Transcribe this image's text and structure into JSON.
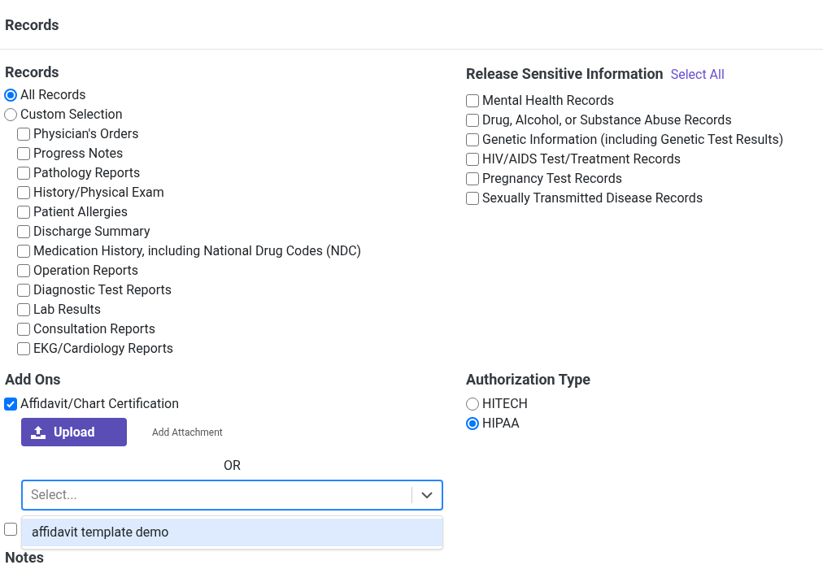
{
  "page_title": "Records",
  "records": {
    "heading": "Records",
    "options": [
      {
        "label": "All Records",
        "selected": true
      },
      {
        "label": "Custom Selection",
        "selected": false
      }
    ],
    "items": [
      {
        "label": "Physician's Orders",
        "checked": false
      },
      {
        "label": "Progress Notes",
        "checked": false
      },
      {
        "label": "Pathology Reports",
        "checked": false
      },
      {
        "label": "History/Physical Exam",
        "checked": false
      },
      {
        "label": "Patient Allergies",
        "checked": false
      },
      {
        "label": "Discharge Summary",
        "checked": false
      },
      {
        "label": "Medication History, including National Drug Codes (NDC)",
        "checked": false
      },
      {
        "label": "Operation Reports",
        "checked": false
      },
      {
        "label": "Diagnostic Test Reports",
        "checked": false
      },
      {
        "label": "Lab Results",
        "checked": false
      },
      {
        "label": "Consultation Reports",
        "checked": false
      },
      {
        "label": "EKG/Cardiology Reports",
        "checked": false
      }
    ]
  },
  "sensitive": {
    "heading": "Release Sensitive Information",
    "select_all": "Select All",
    "items": [
      {
        "label": "Mental Health Records",
        "checked": false
      },
      {
        "label": "Drug, Alcohol, or Substance Abuse Records",
        "checked": false
      },
      {
        "label": "Genetic Information (including Genetic Test Results)",
        "checked": false
      },
      {
        "label": "HIV/AIDS Test/Treatment Records",
        "checked": false
      },
      {
        "label": "Pregnancy Test Records",
        "checked": false
      },
      {
        "label": "Sexually Transmitted Disease Records",
        "checked": false
      }
    ]
  },
  "add_ons": {
    "heading": "Add Ons",
    "items": [
      {
        "label": "Affidavit/Chart Certification",
        "checked": true
      },
      {
        "checked": false
      }
    ],
    "upload_button": "Upload",
    "add_attachment": "Add Attachment",
    "or": "OR",
    "select_placeholder": "Select...",
    "menu_options": [
      {
        "label": "affidavit template demo",
        "selected": true
      }
    ]
  },
  "authorization": {
    "heading": "Authorization Type",
    "options": [
      {
        "label": "HITECH",
        "selected": false
      },
      {
        "label": "HIPAA",
        "selected": true
      }
    ]
  },
  "notes_heading": "Notes"
}
